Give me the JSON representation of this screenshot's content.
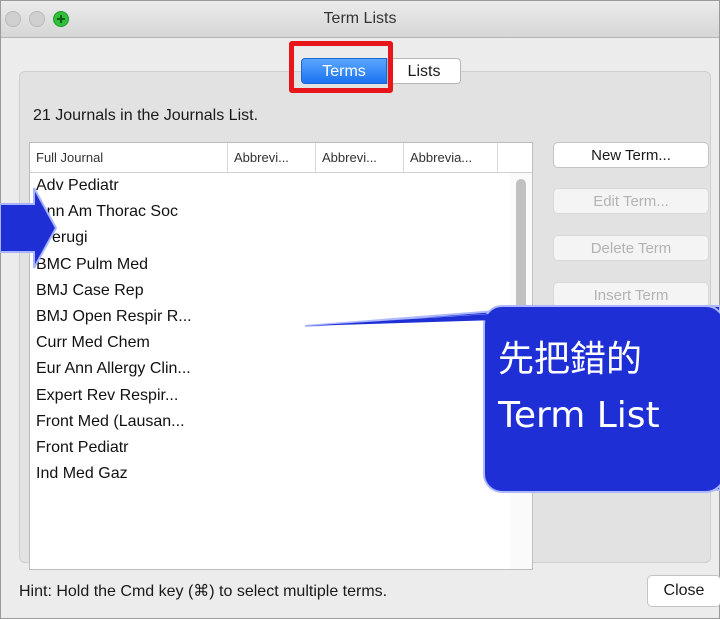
{
  "window": {
    "title": "Term Lists"
  },
  "tabs": [
    {
      "label": "Terms",
      "selected": true
    },
    {
      "label": "Lists",
      "selected": false
    }
  ],
  "summary": "21 Journals in the Journals List.",
  "table": {
    "columns": [
      "Full Journal",
      "Abbrevi...",
      "Abbrevi...",
      "Abbrevia..."
    ],
    "rows": [
      "Adv Pediatr",
      "Ann Am Thorac Soc",
      "Arerugi",
      "BMC Pulm Med",
      "BMJ Case Rep",
      "BMJ Open Respir R...",
      "Curr Med Chem",
      "Eur Ann Allergy Clin...",
      "Expert Rev Respir...",
      "Front Med (Lausan...",
      "Front Pediatr",
      "Ind Med Gaz"
    ]
  },
  "buttons": {
    "new_term": "New Term...",
    "edit_term": "Edit Term...",
    "delete_term": "Delete Term",
    "insert_term": "Insert Term",
    "close": "Close"
  },
  "hint": "Hint: Hold the Cmd key (⌘) to select multiple terms.",
  "callout": {
    "line1": "先把錯的",
    "line2": "Term List",
    "color": "#1f2fd6"
  },
  "colors": {
    "highlight": "#e8151b",
    "selected_tab": "#1a73f0"
  }
}
